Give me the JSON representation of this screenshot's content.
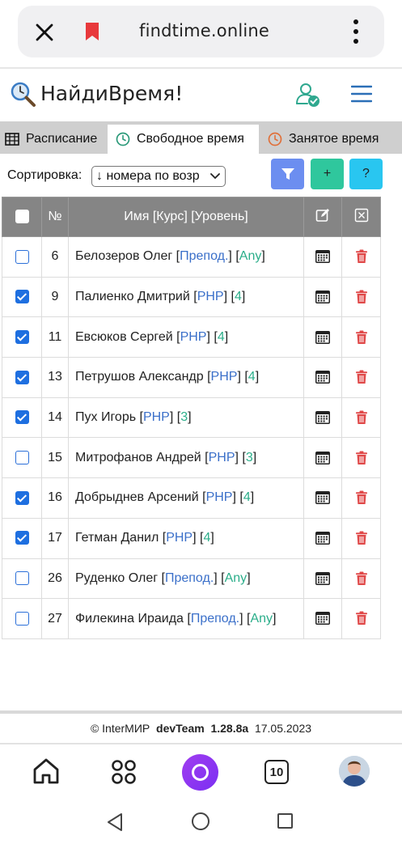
{
  "browser": {
    "url": "findtime.online"
  },
  "app": {
    "title": "НайдиВремя!"
  },
  "tabs": [
    {
      "label": "Расписание",
      "icon": "table-icon",
      "active": false
    },
    {
      "label": "Свободное время",
      "icon": "clock-icon",
      "active": true
    },
    {
      "label": "Занятое время",
      "icon": "clock-icon",
      "active": false
    }
  ],
  "toolbar": {
    "sort_label": "Сортировка:",
    "sort_value": "↓ номера по возр",
    "add_label": "+",
    "help_label": "?"
  },
  "table": {
    "headers": {
      "num": "№",
      "name": "Имя [Курс] [Уровень]"
    },
    "rows": [
      {
        "checked": false,
        "num": "6",
        "name": "Белозеров Олег",
        "course": "Препод.",
        "level": "Any"
      },
      {
        "checked": true,
        "num": "9",
        "name": "Палиенко Дмитрий",
        "course": "PHP",
        "level": "4"
      },
      {
        "checked": true,
        "num": "11",
        "name": "Евсюков Сергей",
        "course": "PHP",
        "level": "4"
      },
      {
        "checked": true,
        "num": "13",
        "name": "Петрушов Александр",
        "course": "PHP",
        "level": "4"
      },
      {
        "checked": true,
        "num": "14",
        "name": "Пух Игорь",
        "course": "PHP",
        "level": "3"
      },
      {
        "checked": false,
        "num": "15",
        "name": "Митрофанов Андрей",
        "course": "PHP",
        "level": "3"
      },
      {
        "checked": true,
        "num": "16",
        "name": "Добрыднев Арсений",
        "course": "PHP",
        "level": "4"
      },
      {
        "checked": true,
        "num": "17",
        "name": "Гетман Данил",
        "course": "PHP",
        "level": "4"
      },
      {
        "checked": false,
        "num": "26",
        "name": "Руденко Олег",
        "course": "Препод.",
        "level": "Any"
      },
      {
        "checked": false,
        "num": "27",
        "name": "Филекина Ираида",
        "course": "Препод.",
        "level": "Any"
      }
    ]
  },
  "footer": {
    "copyright": "© InterМИР",
    "team": "devTeam",
    "version": "1.28.8a",
    "date": "17.05.2023"
  },
  "bottom_nav": {
    "tabs_count": "10"
  },
  "colors": {
    "filter_button": "#6c8ef0",
    "add_button": "#2fc79d",
    "help_button": "#29c6f0",
    "header_row": "#858585",
    "course_text": "#3a6fc9",
    "level_text": "#2bae8a",
    "delete_icon": "#e04848"
  }
}
